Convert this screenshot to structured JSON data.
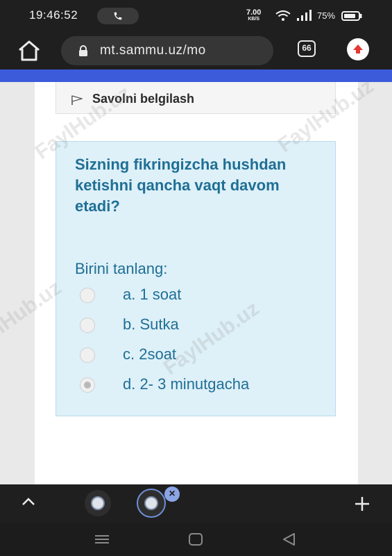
{
  "status_bar": {
    "time": "19:46:52",
    "net_speed_value": "7.00",
    "net_speed_unit": "KB/S",
    "battery": "75%"
  },
  "browser": {
    "url": "mt.sammu.uz/mo",
    "tab_count": "66"
  },
  "page": {
    "flag_label": "Savolni belgilash",
    "question": "Sizning fikringizcha hushdan ketishni qancha vaqt davom etadi?",
    "prompt": "Birini tanlang:",
    "options": [
      {
        "label": "a. 1 soat",
        "selected": false
      },
      {
        "label": "b. Sutka",
        "selected": false
      },
      {
        "label": "c. 2soat",
        "selected": false
      },
      {
        "label": "d. 2- 3 minutgacha",
        "selected": true
      }
    ],
    "watermark": "FaylHub.uz"
  },
  "colors": {
    "accent_bar": "#3b5bdb",
    "question_text": "#1f6f95",
    "card_background": "#def0f8"
  }
}
